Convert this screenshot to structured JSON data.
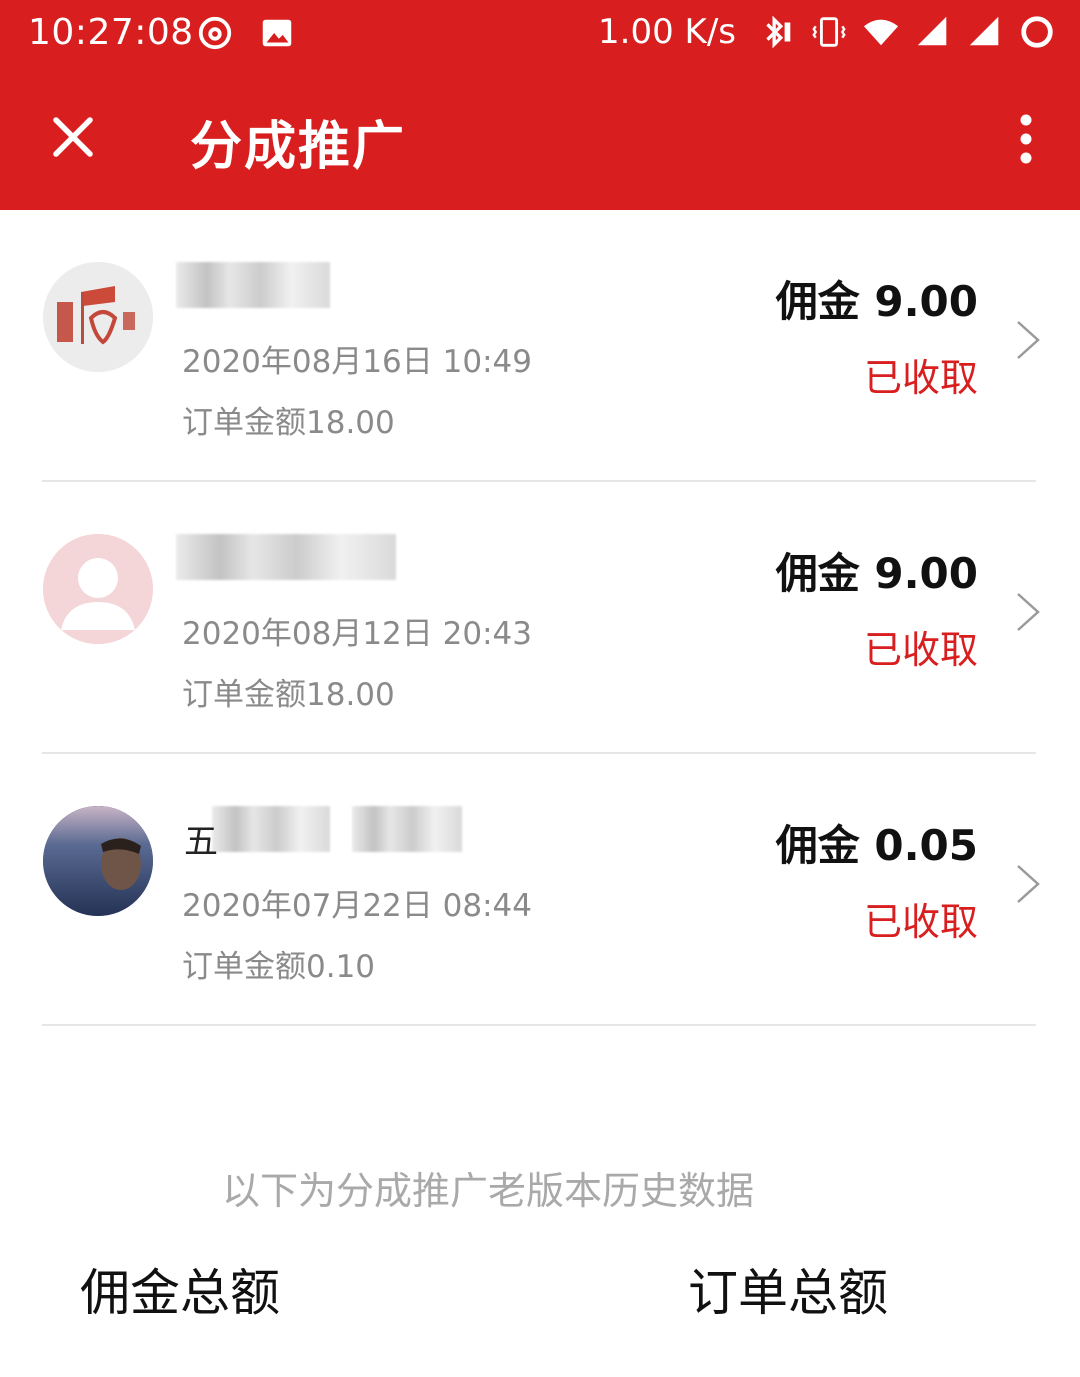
{
  "status_bar": {
    "time": "10:27:08",
    "speed": "1.00 K/s",
    "icons": [
      "netease-music-icon",
      "image-icon",
      "bluetooth-icon",
      "vibrate-icon",
      "wifi-icon",
      "signal-icon",
      "signal-icon-2",
      "battery-ring-icon"
    ]
  },
  "app_bar": {
    "title": "分成推广",
    "close_icon": "close-icon",
    "more_icon": "more-vert-icon"
  },
  "items": [
    {
      "name": "",
      "date": "2020年08月16日 10:49",
      "order_amount": "订单金额18.00",
      "commission": "佣金 9.00",
      "status": "已收取",
      "avatar": "badge-avatar"
    },
    {
      "name": "",
      "date": "2020年08月12日 20:43",
      "order_amount": "订单金额18.00",
      "commission": "佣金 9.00",
      "status": "已收取",
      "avatar": "default-person-avatar"
    },
    {
      "name": "五",
      "date": "2020年07月22日 08:44",
      "order_amount": "订单金额0.10",
      "commission": "佣金 0.05",
      "status": "已收取",
      "avatar": "photo-avatar"
    }
  ],
  "footer": {
    "history_note": "以下为分成推广老版本历史数据",
    "total_commission_label": "佣金总额",
    "total_orders_label": "订单总额"
  },
  "colors": {
    "brand_red": "#d81e1e",
    "muted_text": "#8a8a8a",
    "divider": "#e6e6e6"
  }
}
